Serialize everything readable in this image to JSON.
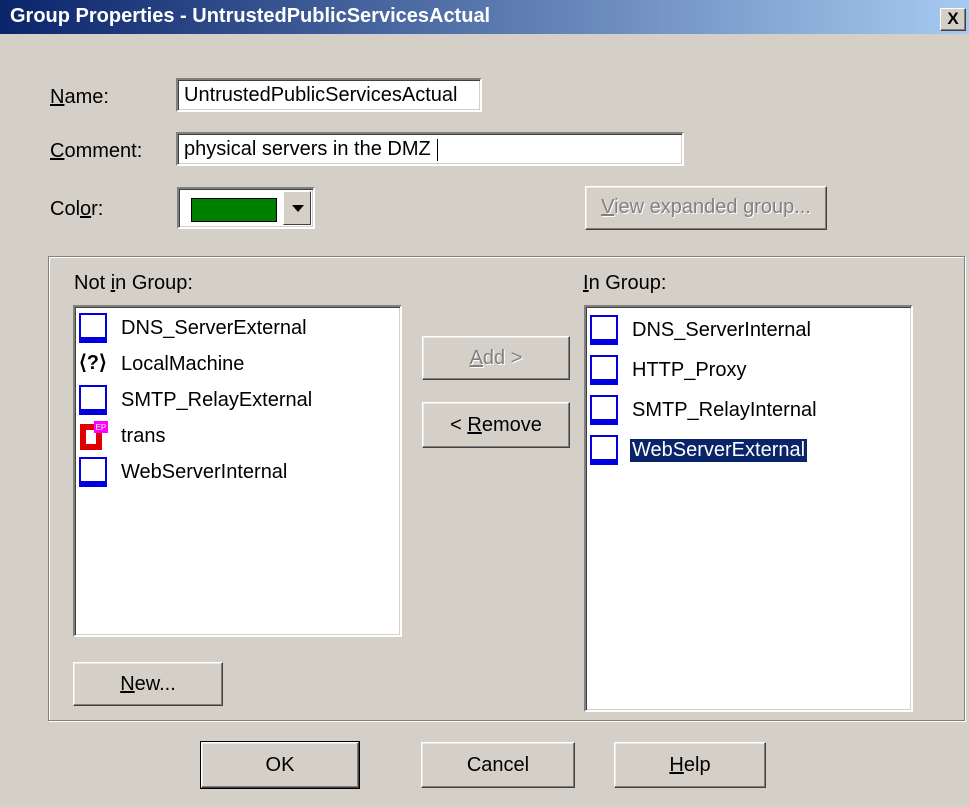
{
  "window": {
    "title": "Group Properties - UntrustedPublicServicesActual",
    "close_label": "X"
  },
  "form": {
    "name_label": "Name:",
    "name_value": "UntrustedPublicServicesActual",
    "comment_label": "Comment:",
    "comment_value": "physical servers in the DMZ",
    "color_label": "Color:",
    "color_value": "#008000",
    "view_expanded_label": "View expanded group..."
  },
  "not_in_group": {
    "label": "Not in Group:",
    "items": [
      {
        "label": "DNS_ServerExternal",
        "icon": "host-icon"
      },
      {
        "label": "LocalMachine",
        "icon": "unknown-object-icon"
      },
      {
        "label": "SMTP_RelayExternal",
        "icon": "host-icon"
      },
      {
        "label": "trans",
        "icon": "address-translation-icon"
      },
      {
        "label": "WebServerInternal",
        "icon": "host-icon"
      }
    ]
  },
  "in_group": {
    "label": "In Group:",
    "items": [
      {
        "label": "DNS_ServerInternal",
        "icon": "host-icon"
      },
      {
        "label": "HTTP_Proxy",
        "icon": "host-icon"
      },
      {
        "label": "SMTP_RelayInternal",
        "icon": "host-icon"
      },
      {
        "label": "WebServerExternal",
        "icon": "host-icon",
        "selected": true
      }
    ]
  },
  "buttons": {
    "add": "Add  >",
    "remove": "<  Remove",
    "new": "New...",
    "ok": "OK",
    "cancel": "Cancel",
    "help": "Help"
  },
  "colors": {
    "title_gradient_start": "#0a246a",
    "title_gradient_end": "#a6caf0",
    "selection": "#0a246a",
    "host_icon": "#0000e0",
    "swatch": "#008000"
  }
}
